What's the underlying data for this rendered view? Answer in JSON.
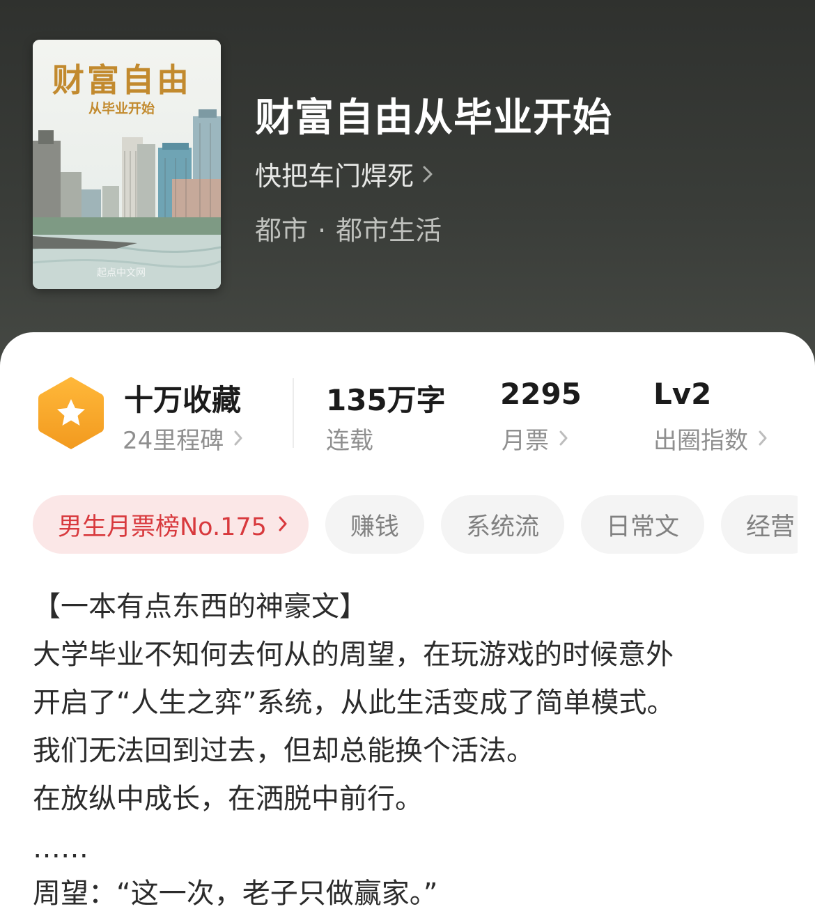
{
  "book": {
    "cover_title": "财富自由",
    "cover_subtitle": "从毕业开始",
    "cover_watermark": "起点中文网",
    "title": "财富自由从毕业开始",
    "author": "快把车门焊死",
    "category": "都市",
    "separator": "·",
    "subcategory": "都市生活"
  },
  "stats": {
    "collections": "十万收藏",
    "milestones": "24里程碑",
    "word_count": "135万字",
    "status": "连载",
    "monthly_tickets": "2295",
    "monthly_tickets_label": "月票",
    "level": "Lv2",
    "level_label": "出圈指数"
  },
  "tags": [
    "男生月票榜No.175",
    "赚钱",
    "系统流",
    "日常文",
    "经营"
  ],
  "description": [
    "【一本有点东西的神豪文】",
    "大学毕业不知何去何从的周望，在玩游戏的时候意外",
    "开启了“人生之弈”系统，从此生活变成了简单模式。",
    "我们无法回到过去，但却总能换个活法。",
    "在放纵中成长，在洒脱中前行。",
    "……",
    "周望：“这一次，老子只做赢家。”"
  ],
  "colors": {
    "header_bg": "#3a3d39",
    "rank_tag_text": "#d8393d",
    "rank_tag_bg": "#fbe7e7",
    "badge_orange": "#f5a523"
  },
  "icons": [
    "chevron-right-icon",
    "star-badge-icon"
  ]
}
